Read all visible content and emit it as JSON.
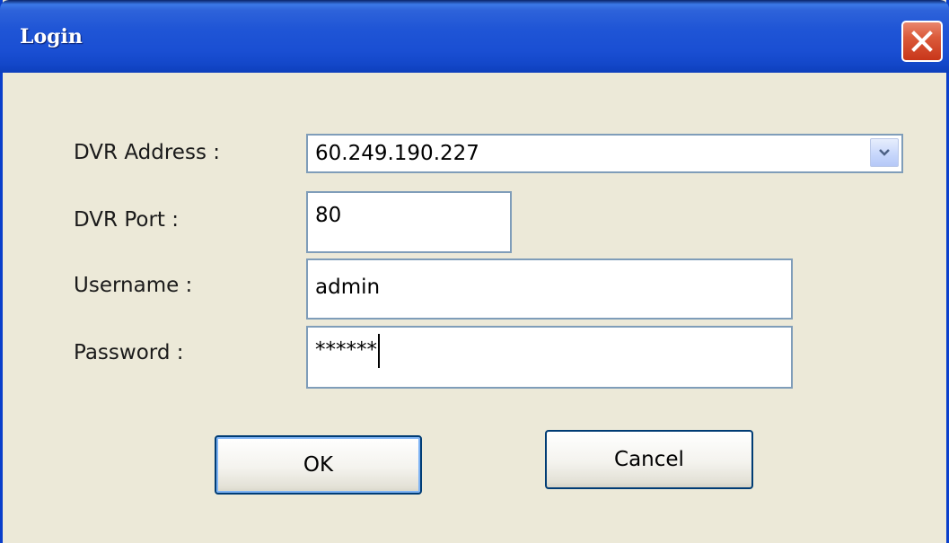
{
  "window": {
    "title": "Login"
  },
  "form": {
    "dvr_address_label": "DVR Address :",
    "dvr_address_value": "60.249.190.227",
    "dvr_port_label": "DVR Port :",
    "dvr_port_value": "80",
    "username_label": "Username :",
    "username_value": "admin",
    "password_label": "Password :",
    "password_value": "******"
  },
  "buttons": {
    "ok_label": "OK",
    "cancel_label": "Cancel"
  },
  "icons": {
    "close": "close-icon",
    "dropdown": "chevron-down-icon"
  },
  "colors": {
    "titlebar": "#1F55D6",
    "close_button": "#D9512F",
    "dialog_background": "#ECE9D8",
    "field_border": "#7F9DB9",
    "button_border": "#003C74"
  }
}
